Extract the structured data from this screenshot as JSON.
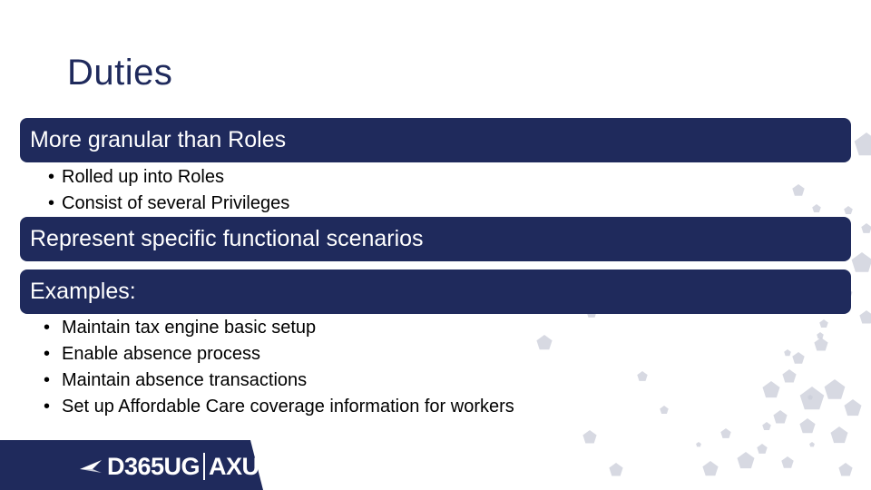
{
  "slide": {
    "title": "Duties",
    "sections": [
      {
        "heading": "More granular than Roles",
        "bullets": [
          "Rolled up into Roles",
          "Consist of several Privileges"
        ]
      },
      {
        "heading": "Represent specific functional scenarios",
        "bullets": []
      },
      {
        "heading": "Examples:",
        "bullets": [
          "Maintain tax engine basic setup",
          "Enable absence process",
          "Maintain absence transactions",
          "Set up Affordable Care coverage information for workers"
        ]
      }
    ],
    "bullet_glyph": "•"
  },
  "footer": {
    "logo_left": "D365UG",
    "logo_right": "AXUG",
    "logo_icon": "arrow-icon"
  },
  "colors": {
    "navy": "#1f2a5c",
    "decoration": "#c9ccd8"
  }
}
